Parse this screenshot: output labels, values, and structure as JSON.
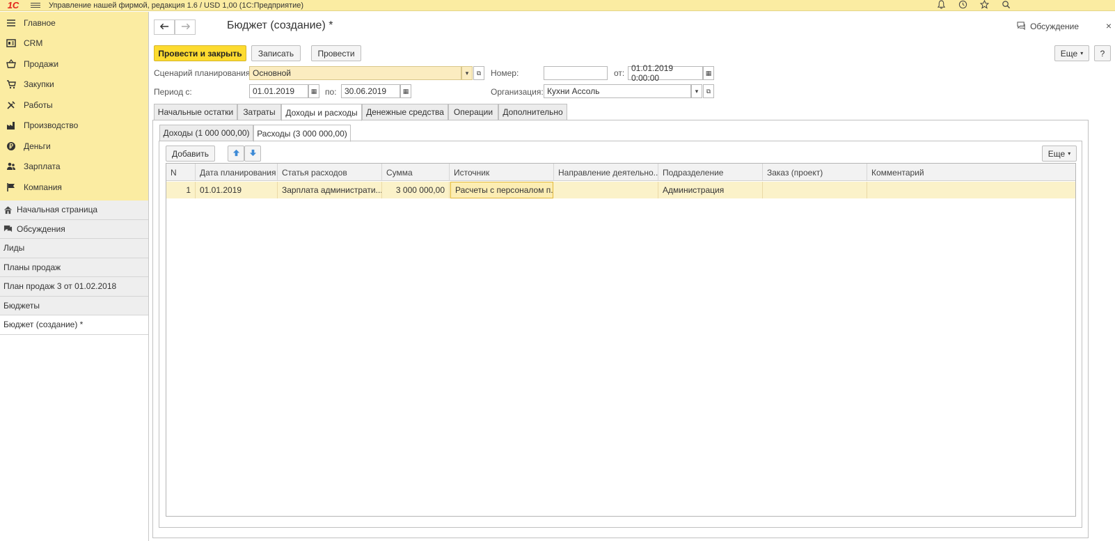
{
  "app": {
    "logo": "1С",
    "title": "Управление нашей фирмой, редакция 1.6 / USD 1,00   (1С:Предприятие)"
  },
  "sections": [
    {
      "label": "Главное",
      "icon": "menu-icon"
    },
    {
      "label": "CRM",
      "icon": "crm-icon"
    },
    {
      "label": "Продажи",
      "icon": "basket-icon"
    },
    {
      "label": "Закупки",
      "icon": "cart-icon"
    },
    {
      "label": "Работы",
      "icon": "tools-icon"
    },
    {
      "label": "Производство",
      "icon": "factory-icon"
    },
    {
      "label": "Деньги",
      "icon": "ruble-icon"
    },
    {
      "label": "Зарплата",
      "icon": "people-icon"
    },
    {
      "label": "Компания",
      "icon": "flag-icon"
    }
  ],
  "open_windows": [
    {
      "label": "Начальная страница",
      "icon": "home-icon"
    },
    {
      "label": "Обсуждения",
      "icon": "chat-icon"
    },
    {
      "label": "Лиды"
    },
    {
      "label": "Планы продаж"
    },
    {
      "label": "План продаж 3 от 01.02.2018"
    },
    {
      "label": "Бюджеты"
    },
    {
      "label": "Бюджет (создание) *"
    }
  ],
  "form": {
    "title": "Бюджет (создание) *",
    "discuss_label": "Обсуждение",
    "close_label": "×"
  },
  "toolbar": {
    "post_close": "Провести и закрыть",
    "save": "Записать",
    "post": "Провести",
    "more": "Еще",
    "help": "?"
  },
  "fields": {
    "scenario_label": "Сценарий планирования:",
    "scenario_value": "Основной",
    "number_label": "Номер:",
    "number_value": "",
    "from_label": "от:",
    "from_value": "01.01.2019  0:00:00",
    "period_label": "Период с:",
    "period_from": "01.01.2019",
    "period_to_label": "по:",
    "period_to": "30.06.2019",
    "org_label": "Организация:",
    "org_value": "Кухни Ассоль"
  },
  "tabs": [
    "Начальные остатки",
    "Затраты",
    "Доходы и расходы",
    "Денежные средства",
    "Операции",
    "Дополнительно"
  ],
  "subtabs": [
    "Доходы (1 000 000,00)",
    "Расходы (3 000 000,00)"
  ],
  "table_toolbar": {
    "add": "Добавить",
    "more": "Еще"
  },
  "table": {
    "columns": [
      "N",
      "Дата планирования",
      "Статья расходов",
      "Сумма",
      "Источник",
      "Направление деятельно...",
      "Подразделение",
      "Заказ (проект)",
      "Комментарий"
    ],
    "rows": [
      [
        "1",
        "01.01.2019",
        "Зарплата администрати...",
        "3 000 000,00",
        "Расчеты с персоналом п...",
        "",
        "Администрация",
        "",
        ""
      ]
    ]
  },
  "colors": {
    "section_bg": "#fbeca2",
    "primary_button": "#fddb2f",
    "row_highlight": "#fbf2c9",
    "logo_red": "#e2231a"
  }
}
